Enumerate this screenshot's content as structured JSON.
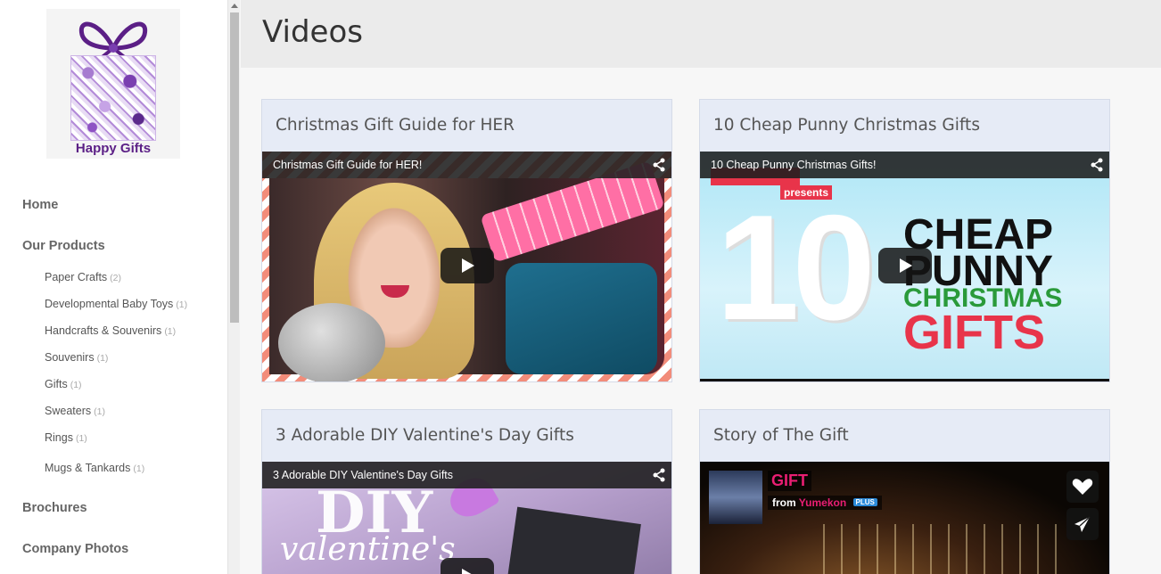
{
  "brand": {
    "logo_text": "Happy Gifts"
  },
  "sidebar": {
    "main_items": [
      {
        "label": "Home"
      },
      {
        "label": "Our Products"
      },
      {
        "label": "Brochures"
      },
      {
        "label": "Company Photos"
      }
    ],
    "sub_items": [
      {
        "label": "Paper Crafts",
        "count": "(2)"
      },
      {
        "label": "Developmental Baby Toys",
        "count": "(1)"
      },
      {
        "label": "Handcrafts & Souvenirs",
        "count": "(1)"
      },
      {
        "label": "Souvenirs",
        "count": "(1)"
      },
      {
        "label": "Gifts",
        "count": "(1)"
      },
      {
        "label": "Sweaters",
        "count": "(1)"
      },
      {
        "label": "Rings",
        "count": "(1)"
      },
      {
        "label": "Mugs & Tankards",
        "count": "(1)"
      }
    ]
  },
  "page": {
    "title": "Videos"
  },
  "videos": [
    {
      "card_title": "Christmas Gift Guide for HER",
      "caption": "Christmas Gift Guide for HER!"
    },
    {
      "card_title": "10 Cheap Punny Christmas Gifts",
      "caption": "10 Cheap Punny Christmas Gifts!",
      "thumb": {
        "badge": "presents",
        "big_number": "10",
        "words": [
          "CHEAP",
          "PUNNY",
          "CHRISTMAS",
          "GIFTS"
        ]
      }
    },
    {
      "card_title": "3 Adorable DIY Valentine's Day Gifts",
      "caption": "3 Adorable DIY Valentine's Day Gifts",
      "thumb": {
        "line1": "DIY",
        "line2": "valentine's"
      }
    },
    {
      "card_title": "Story of The Gift",
      "vimeo": {
        "title": "GIFT",
        "from_label": "from",
        "author": "Yumekon",
        "badge": "PLUS"
      }
    }
  ],
  "colors": {
    "punny_green": "#2a9a3a",
    "punny_red": "#e8344a",
    "vimeo_pink": "#e91e73",
    "card_bg": "#e6ebf6"
  }
}
